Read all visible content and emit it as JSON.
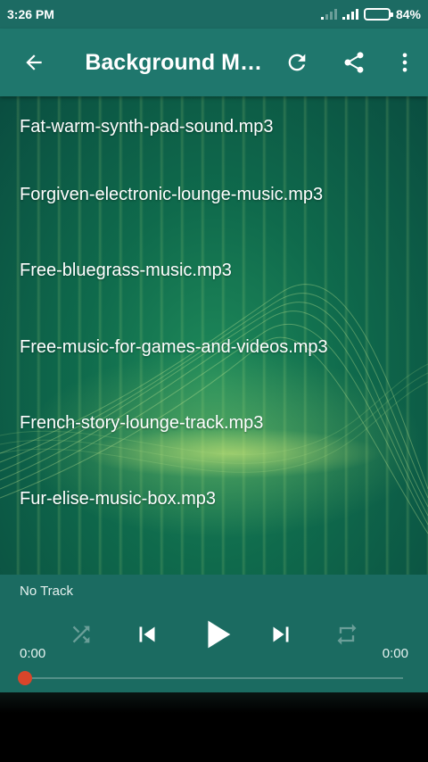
{
  "status_bar": {
    "time": "3:26 PM",
    "battery": "84%"
  },
  "app_bar": {
    "title": "Background Music",
    "back_icon": "arrow-left-icon",
    "refresh_icon": "refresh-icon",
    "share_icon": "share-icon",
    "more_icon": "more-vert-icon"
  },
  "tracks": [
    "Fat-warm-synth-pad-sound.mp3",
    "Forgiven-electronic-lounge-music.mp3",
    "Free-bluegrass-music.mp3",
    "Free-music-for-games-and-videos.mp3",
    "French-story-lounge-track.mp3",
    "Fur-elise-music-box.mp3"
  ],
  "player": {
    "now_playing": "No Track",
    "elapsed": "0:00",
    "total": "0:00",
    "progress": 0,
    "accent_color": "#d9452a"
  }
}
